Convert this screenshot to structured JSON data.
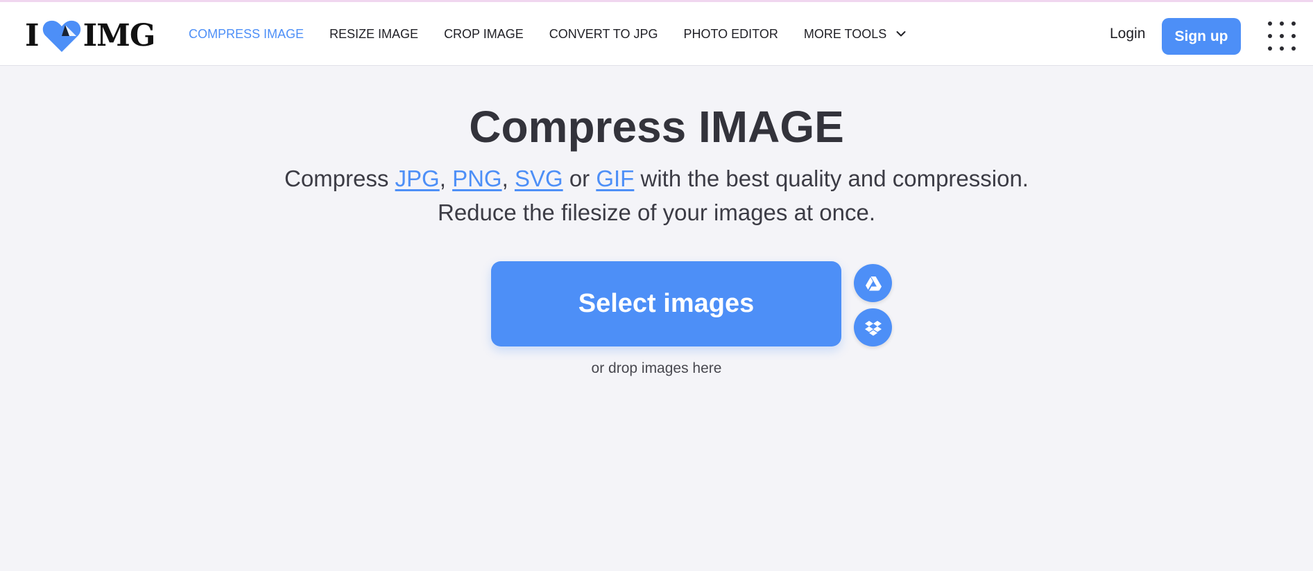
{
  "header": {
    "logo": {
      "left": "I",
      "right": "IMG",
      "heart_color": "#4d8ff7"
    },
    "nav": [
      {
        "label": "COMPRESS IMAGE",
        "active": true
      },
      {
        "label": "RESIZE IMAGE"
      },
      {
        "label": "CROP IMAGE"
      },
      {
        "label": "CONVERT TO JPG"
      },
      {
        "label": "PHOTO EDITOR"
      },
      {
        "label": "MORE TOOLS",
        "icon": "chevron-down-icon"
      }
    ],
    "login_label": "Login",
    "signup_label": "Sign up",
    "apps_icon": "grid-menu-icon"
  },
  "main": {
    "title": "Compress IMAGE",
    "subtitle": {
      "prefix": "Compress",
      "formats": [
        "JPG",
        "PNG",
        "SVG",
        "GIF"
      ],
      "comma": ",",
      "or": "or",
      "suffix": "with the best quality and compression."
    },
    "subtitle_line2": "Reduce the filesize of your images at once.",
    "select_button": "Select images",
    "cloud_buttons": [
      "google-drive-icon",
      "dropbox-icon"
    ],
    "drop_hint": "or drop images here"
  },
  "colors": {
    "accent": "#4d8ff7",
    "background": "#f4f4f8",
    "text": "#33333b"
  }
}
